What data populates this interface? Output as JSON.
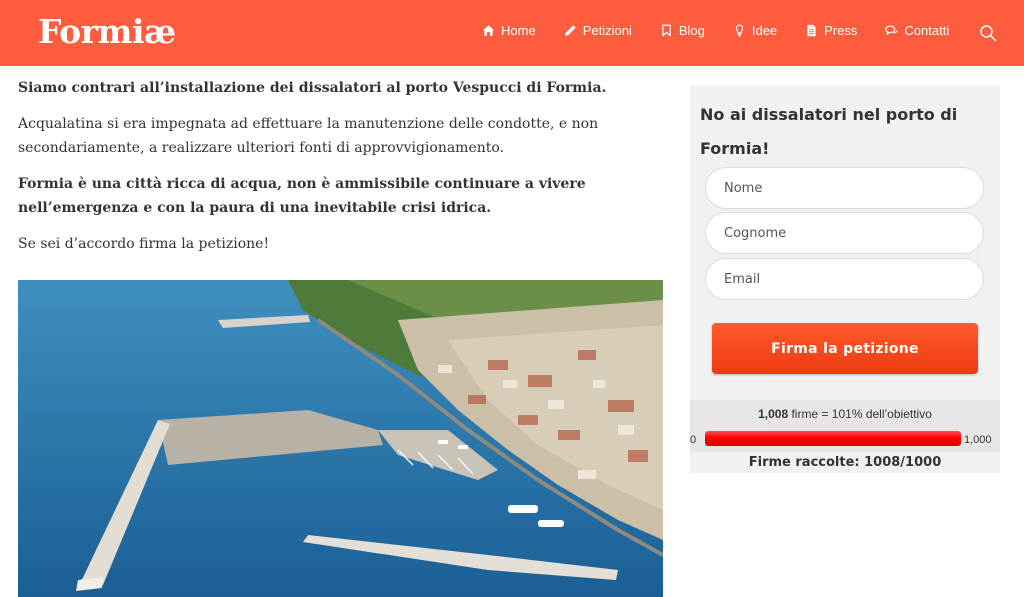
{
  "header": {
    "logo": "Formiæ",
    "nav": [
      {
        "label": "Home",
        "icon": "home-icon"
      },
      {
        "label": "Petizioni",
        "icon": "pencil-icon"
      },
      {
        "label": "Blog",
        "icon": "bookmark-icon"
      },
      {
        "label": "Idee",
        "icon": "lightbulb-icon"
      },
      {
        "label": "Press",
        "icon": "document-icon"
      },
      {
        "label": "Contatti",
        "icon": "chat-icon"
      }
    ],
    "search_icon": "search-icon",
    "color": "#fd5c3e"
  },
  "article": {
    "p1": "Siamo contrari all’installazione dei dissalatori al porto Vespucci di Formia.",
    "p2": "Acqualatina si era impegnata ad effettuare la manutenzione delle condotte, e non secondariamente, a realizzare ulteriori fonti di approvvigionamento.",
    "p3": "Formia è una città ricca di acqua, non è ammissibile continuare a vivere nell’emergenza e con la paura di una inevitabile crisi idrica.",
    "p4": "Se sei d’accordo firma la petizione!"
  },
  "sidebar": {
    "title": "No ai dissalatori nel porto di Formia!",
    "fields": {
      "name_placeholder": "Nome",
      "surname_placeholder": "Cognome",
      "email_placeholder": "Email"
    },
    "button_label": "Firma la petizione",
    "goal": {
      "signatures": "1,008",
      "suffix": "firme = 101% dell’obiettivo",
      "min": "0",
      "max": "1,000",
      "progress": 1.0
    },
    "collected": "Firme raccolte: 1008/1000"
  }
}
